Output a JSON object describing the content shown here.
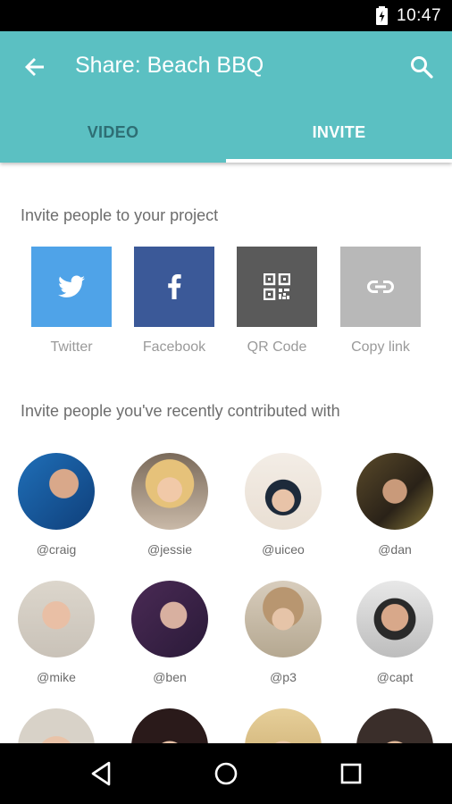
{
  "status": {
    "time": "10:47"
  },
  "appbar": {
    "title": "Share: Beach BBQ"
  },
  "tabs": [
    {
      "label": "VIDEO"
    },
    {
      "label": "INVITE"
    }
  ],
  "sections": {
    "invite_project": "Invite people to your project",
    "recent": "Invite people you've recently contributed with"
  },
  "share_options": [
    {
      "label": "Twitter",
      "color": "#4fa3e8",
      "icon": "twitter-icon"
    },
    {
      "label": "Facebook",
      "color": "#3b5998",
      "icon": "facebook-icon"
    },
    {
      "label": "QR Code",
      "color": "#5a5a5a",
      "icon": "qr-code-icon"
    },
    {
      "label": "Copy link",
      "color": "#b8b8b8",
      "icon": "link-icon"
    }
  ],
  "people": [
    {
      "handle": "@craig"
    },
    {
      "handle": "@jessie"
    },
    {
      "handle": "@uiceo"
    },
    {
      "handle": "@dan"
    },
    {
      "handle": "@mike"
    },
    {
      "handle": "@ben"
    },
    {
      "handle": "@p3"
    },
    {
      "handle": "@capt"
    }
  ],
  "colors": {
    "accent": "#5bc0c2",
    "tab_inactive": "#2e6e74"
  }
}
